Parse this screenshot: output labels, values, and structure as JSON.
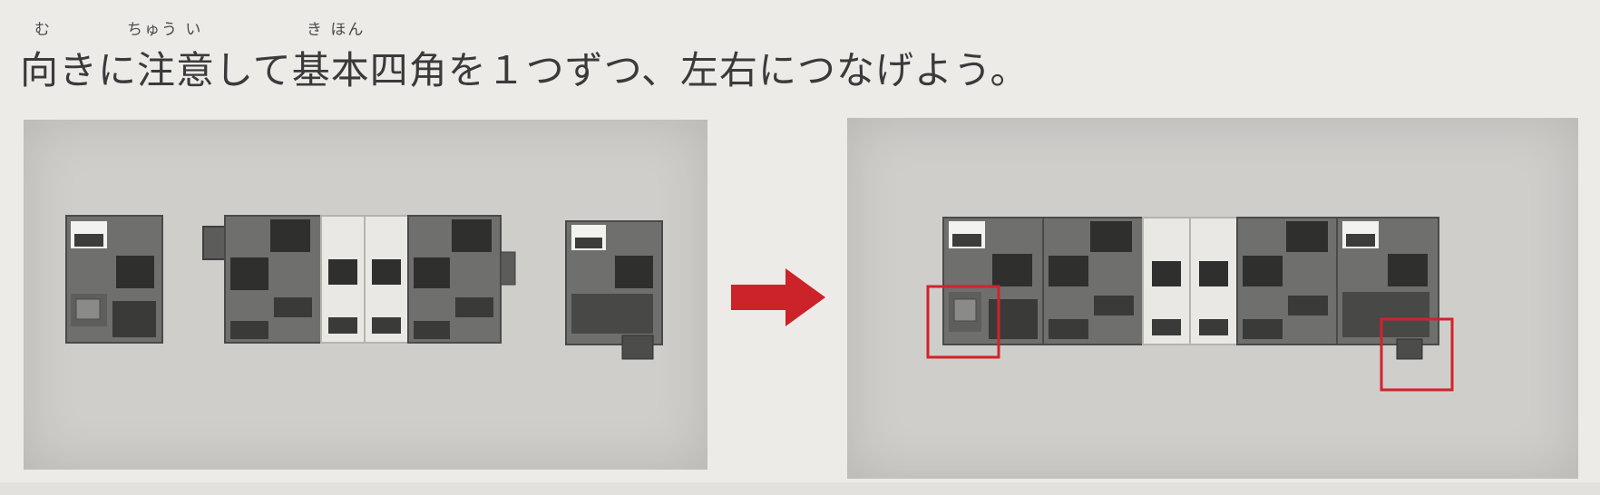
{
  "instruction": {
    "text": "向きに注意して基本四角を１つずつ、左右につなげよう。",
    "ruby": {
      "muki": "む",
      "chuui": "ちゅう い",
      "kihon": "き ほん"
    }
  },
  "colors": {
    "dark_block": "#6e6e6c",
    "light_block": "#e9e8e4",
    "highlight_box": "#d0232a",
    "arrow": "#cc2229"
  },
  "panels": {
    "before": {
      "description_icon": "separated-blocks"
    },
    "after": {
      "description_icon": "connected-blocks"
    }
  }
}
